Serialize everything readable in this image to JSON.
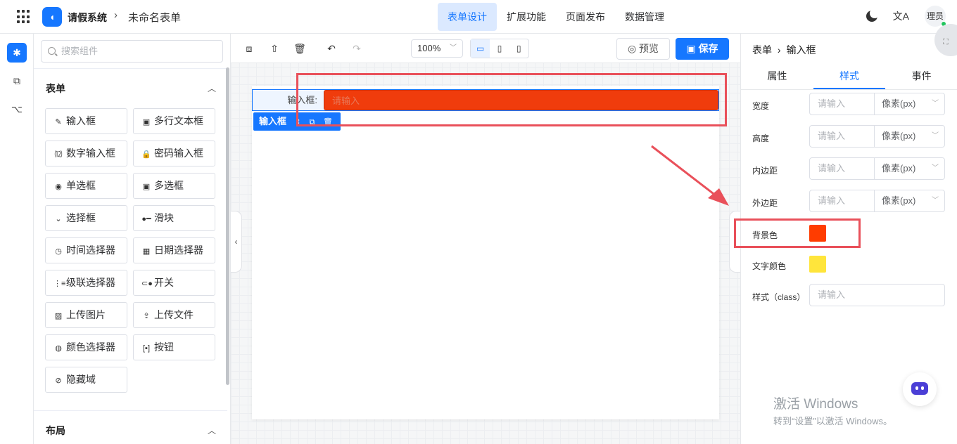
{
  "header": {
    "app_name": "请假系统",
    "separator": "›",
    "form_name": "未命名表单",
    "logo_glyph": "◖",
    "nav": [
      {
        "label": "表单设计",
        "active": true
      },
      {
        "label": "扩展功能",
        "active": false
      },
      {
        "label": "页面发布",
        "active": false
      },
      {
        "label": "数据管理",
        "active": false
      }
    ],
    "translate_icon": "文A",
    "user_avatar": "理员"
  },
  "sidebar_icons": [
    "puzzle-icon",
    "code-block-icon",
    "flow-icon"
  ],
  "components": {
    "search_placeholder": "搜索组件",
    "section_form": "表单",
    "section_layout": "布局",
    "items": [
      {
        "label": "输入框",
        "icon": "✎"
      },
      {
        "label": "多行文本框",
        "icon": "▣"
      },
      {
        "label": "数字输入框",
        "icon": "⑿"
      },
      {
        "label": "密码输入框",
        "icon": "🔒"
      },
      {
        "label": "单选框",
        "icon": "◉"
      },
      {
        "label": "多选框",
        "icon": "▣"
      },
      {
        "label": "选择框",
        "icon": "⌄"
      },
      {
        "label": "滑块",
        "icon": "●━"
      },
      {
        "label": "时间选择器",
        "icon": "◷"
      },
      {
        "label": "日期选择器",
        "icon": "▦"
      },
      {
        "label": "级联选择器",
        "icon": "⋮≡"
      },
      {
        "label": "开关",
        "icon": "⊂●"
      },
      {
        "label": "上传图片",
        "icon": "▨"
      },
      {
        "label": "上传文件",
        "icon": "⇪"
      },
      {
        "label": "颜色选择器",
        "icon": "◍"
      },
      {
        "label": "按钮",
        "icon": "[▪]"
      },
      {
        "label": "隐藏域",
        "icon": "⊘"
      }
    ]
  },
  "toolbar": {
    "zoom": "100%",
    "preview_label": "预览",
    "save_label": "保存",
    "devices": [
      "desktop",
      "tablet",
      "mobile"
    ]
  },
  "canvas": {
    "field_label": "输入框:",
    "field_placeholder": "请输入",
    "field_bg_color": "#f03c0c",
    "selected_tag": "输入框"
  },
  "props": {
    "crumb_root": "表单",
    "crumb_sep": "›",
    "crumb_leaf": "输入框",
    "tabs": [
      {
        "label": "属性",
        "active": false
      },
      {
        "label": "样式",
        "active": true
      },
      {
        "label": "事件",
        "active": false
      }
    ],
    "rows": [
      {
        "label": "宽度",
        "placeholder": "请输入",
        "unit": "像素(px)"
      },
      {
        "label": "高度",
        "placeholder": "请输入",
        "unit": "像素(px)"
      },
      {
        "label": "内边距",
        "placeholder": "请输入",
        "unit": "像素(px)"
      },
      {
        "label": "外边距",
        "placeholder": "请输入",
        "unit": "像素(px)"
      }
    ],
    "bg_color_label": "背景色",
    "bg_color": "#ff3c00",
    "text_color_label": "文字颜色",
    "text_color": "#ffe53b",
    "class_label": "样式（class）",
    "class_placeholder": "请输入"
  },
  "watermark": {
    "line1": "激活 Windows",
    "line2": "转到“设置”以激活 Windows。"
  },
  "annotation_color": "#e9505a"
}
